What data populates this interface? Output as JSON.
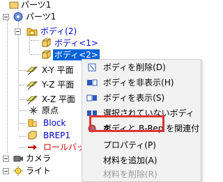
{
  "tree": {
    "parts_root": "パーツ1",
    "parts_node": "パーツ1",
    "body_folder": "ボディ(2)",
    "body1": "ボディ<1>",
    "body2": "ボディ<2>",
    "plane_xy": "X-Y 平面",
    "plane_yz": "Y-Z 平面",
    "plane_xz": "X-Z 平面",
    "origin": "原点",
    "block": "Block",
    "brep": "BREP1",
    "rollback": "ロールバック",
    "camera": "カメラ",
    "light": "ライト"
  },
  "menu": {
    "items": [
      {
        "label": "ボディを削除(D)",
        "icon": "delete-body-icon"
      },
      {
        "label": "ボディを非表示(H)",
        "icon": "hide-body-icon"
      },
      {
        "label": "ボディを表示(S)",
        "icon": "show-body-icon"
      },
      {
        "label": "選択されていないボディを",
        "icon": "unselected-body-icon"
      },
      {
        "label": "ボディと B-Rep を関連付",
        "icon": "associate-brep-icon"
      },
      {
        "label": "プロパティ(P)",
        "icon": ""
      },
      {
        "label": "材料を追加(A)",
        "icon": ""
      },
      {
        "label": "材料を削除(R)",
        "icon": ""
      }
    ]
  },
  "colors": {
    "selection": "#0a64d8",
    "highlight_box": "#e03333",
    "body_label": "#0000cc",
    "rollback": "#d40000"
  }
}
